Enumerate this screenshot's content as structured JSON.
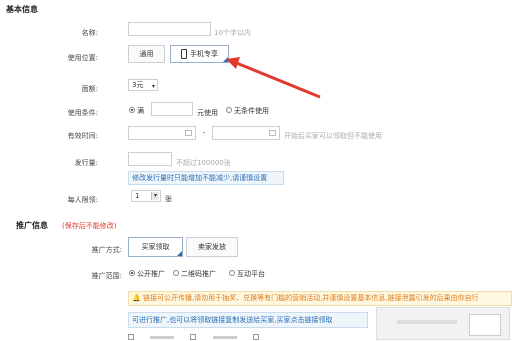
{
  "sections": {
    "basic_title": "基本信息",
    "promo_title": "推广信息",
    "promo_warning": "(保存后不能修改)"
  },
  "name": {
    "label": "名称:",
    "hint": "10个字以内",
    "value": ""
  },
  "usage": {
    "label": "使用位置:",
    "opt_general": "通用",
    "opt_mobile": "手机专享"
  },
  "denomination": {
    "label": "面额:",
    "value": "3元"
  },
  "condition": {
    "label": "使用条件:",
    "opt_full": "满",
    "unit_text": "元使用",
    "opt_none": "无条件使用"
  },
  "validity": {
    "label": "有效时间:",
    "dash": "-",
    "hint": "开始后买家可以领取但不能使用"
  },
  "quantity": {
    "label": "发行量:",
    "hint": "不超过100000张",
    "tip": "修改发行量时只能增加不能减少,请谨慎设置"
  },
  "per_person": {
    "label": "每人限领:",
    "value": "1",
    "unit": "张"
  },
  "promo_method": {
    "label": "推广方式:",
    "opt_buyer": "买家领取",
    "opt_seller": "卖家发放"
  },
  "promo_range": {
    "label": "推广范围:",
    "opt_public": "公开推广",
    "opt_qr": "二维码推广",
    "opt_interactive": "互动平台"
  },
  "notices": {
    "yellow": "链接可公开传播,请勿用于抽奖、兑换等有门槛的营销活动,并谨慎设置基本信息,链接泄露引发的后果由你自行",
    "blue": "可进行推广,也可以将领取链接复制发送给买家,买家点击链接领取"
  },
  "colors": {
    "arrow": "#e03a2f",
    "warn": "#e03a2f",
    "tip_blue": "#2a6db5",
    "tip_yellow": "#e07b19"
  }
}
